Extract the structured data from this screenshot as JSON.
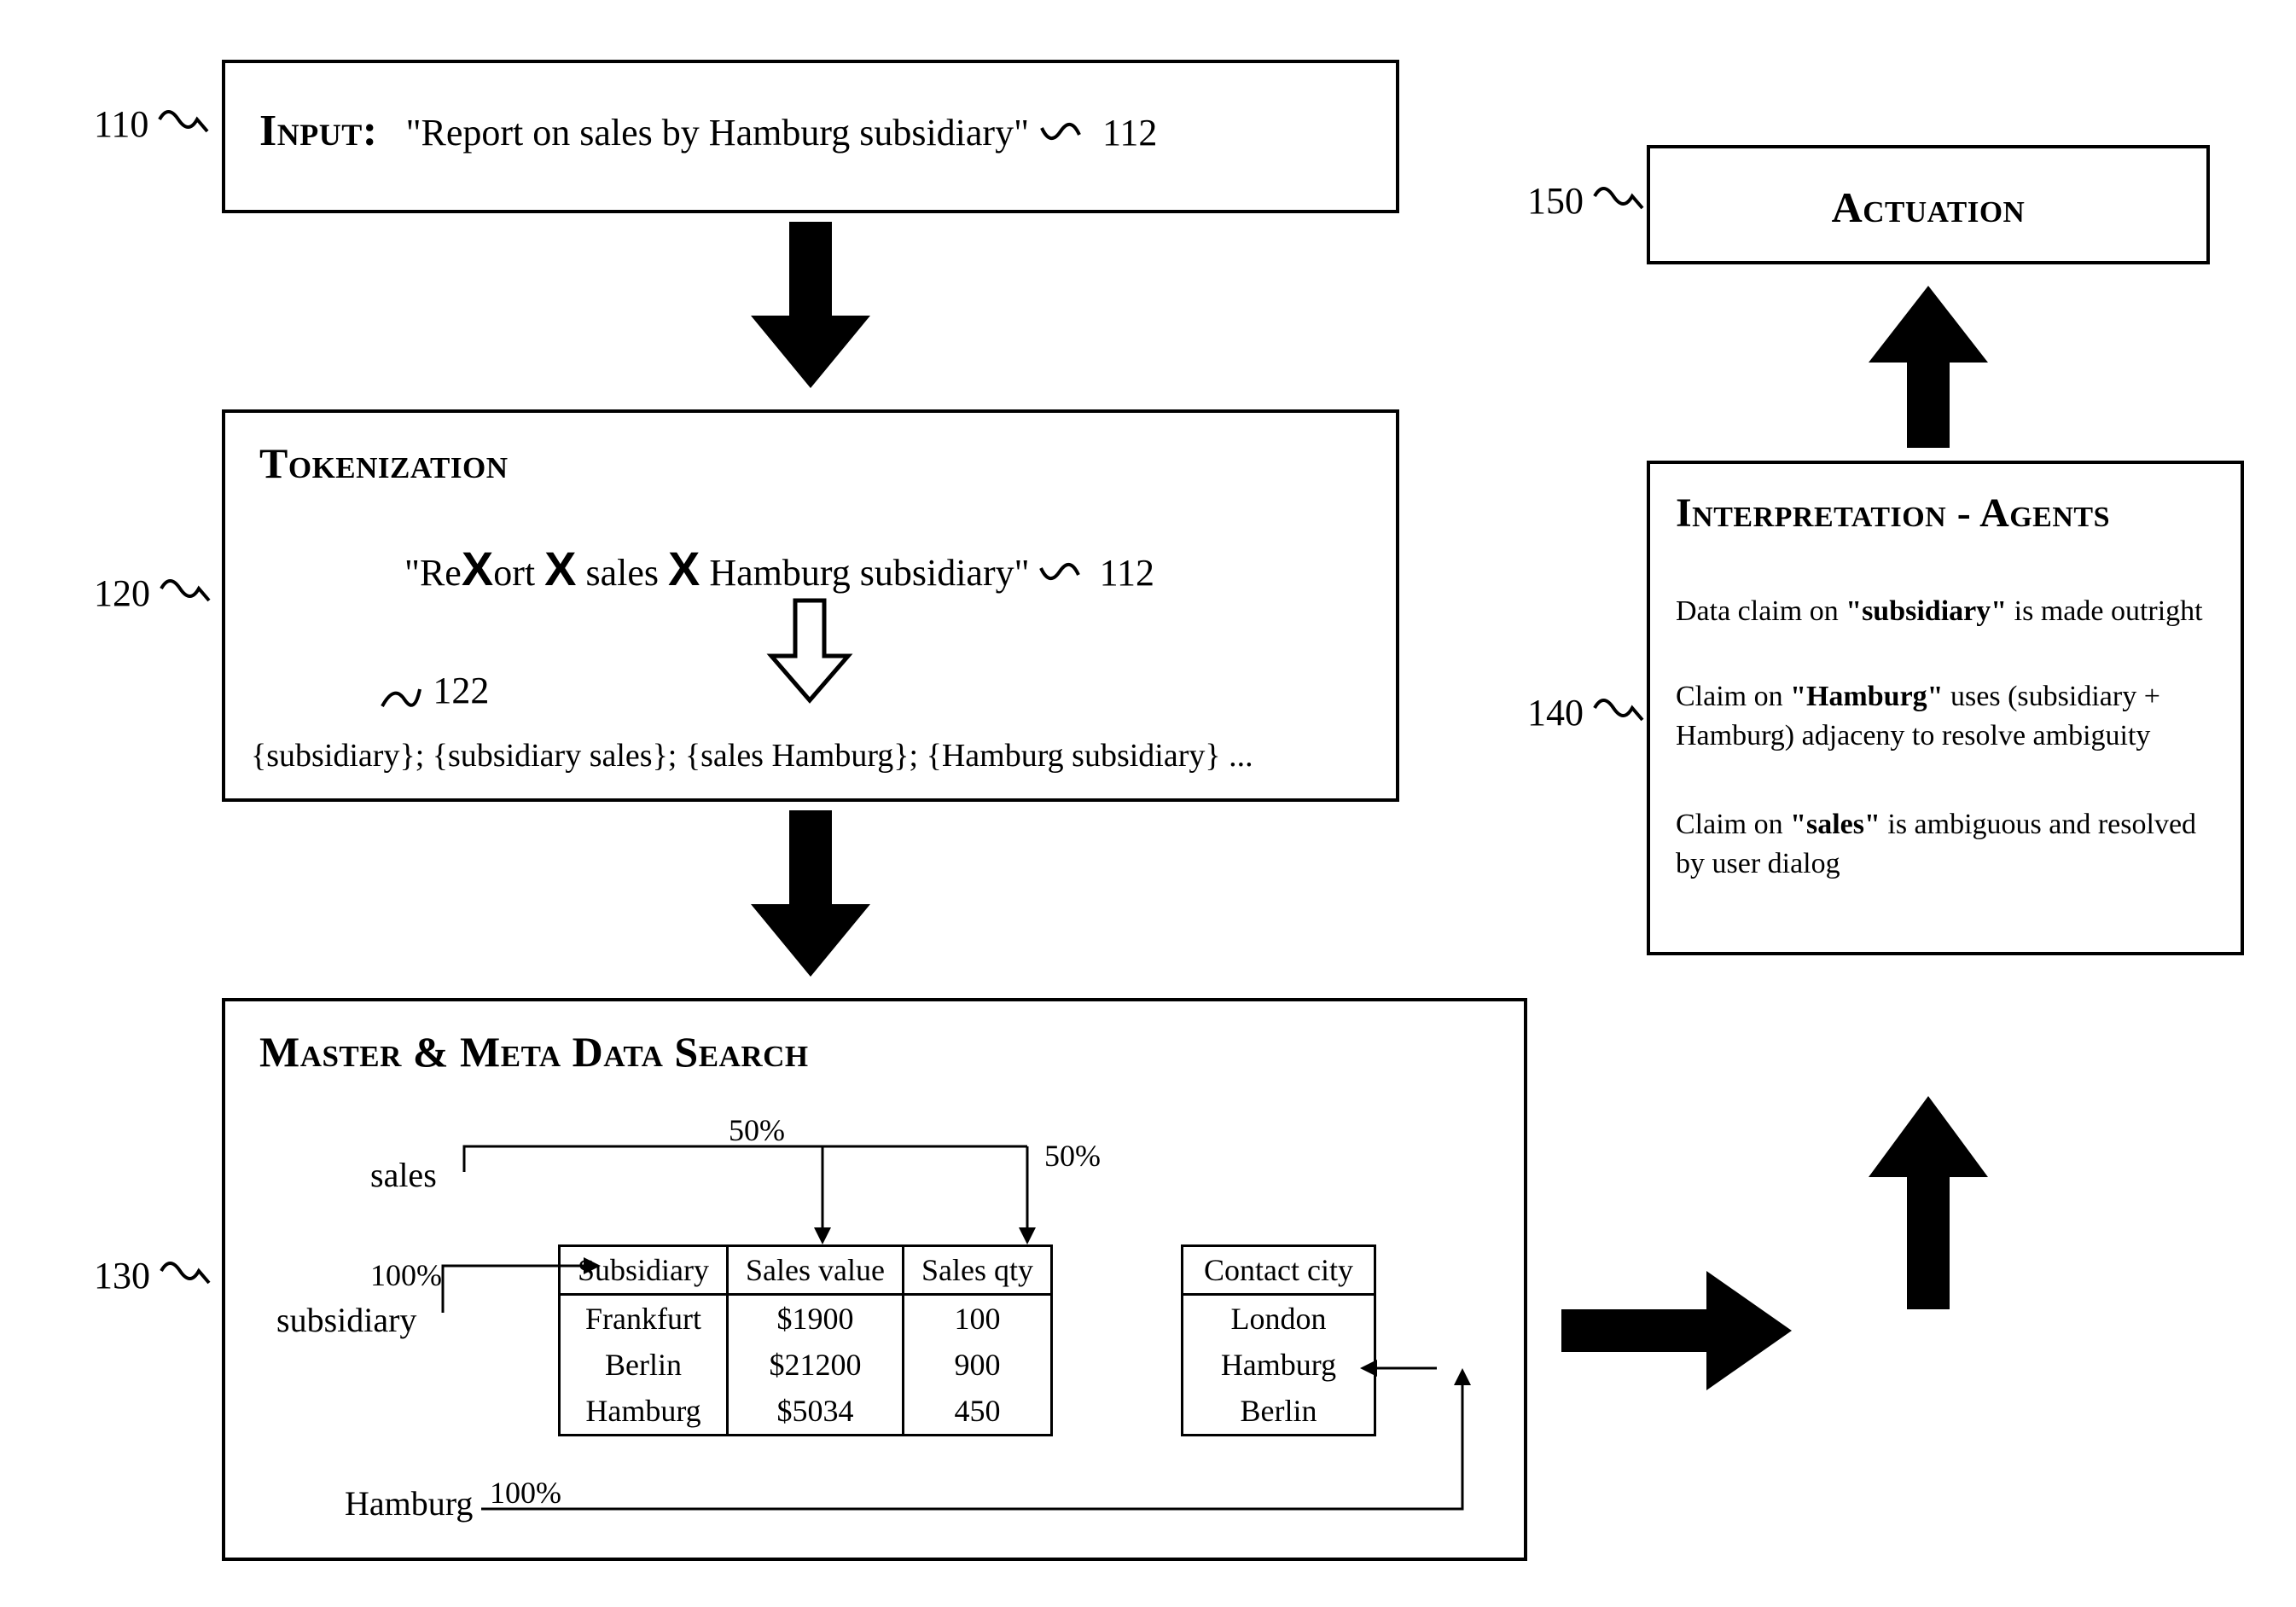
{
  "refs": {
    "r110": "110",
    "r112a": "112",
    "r112b": "112",
    "r120": "120",
    "r122": "122",
    "r130": "130",
    "r140": "140",
    "r150": "150"
  },
  "input": {
    "heading": "Input:",
    "text": "\"Report on sales by Hamburg subsidiary\""
  },
  "tokenization": {
    "heading": "Tokenization",
    "sentence_pre_x1": "\"Re",
    "sentence_mid1": "ort",
    "sentence_mid2": "sales",
    "sentence_mid3": "Hamburg subsidiary\"",
    "tokens_line": "{subsidiary}; {subsidiary sales}; {sales Hamburg}; {Hamburg subsidiary} ..."
  },
  "search": {
    "heading": "Master & Meta Data Search",
    "labels": {
      "sales": "sales",
      "subsidiary": "subsidiary",
      "hamburg": "Hamburg",
      "p50a": "50%",
      "p50b": "50%",
      "p100a": "100%",
      "p100b": "100%"
    },
    "table": {
      "headers": [
        "Subsidiary",
        "Sales value",
        "Sales qty"
      ],
      "rows": [
        [
          "Frankfurt",
          "$1900",
          "100"
        ],
        [
          "Berlin",
          "$21200",
          "900"
        ],
        [
          "Hamburg",
          "$5034",
          "450"
        ]
      ]
    },
    "contact": {
      "header": "Contact city",
      "rows": [
        "London",
        "Hamburg",
        "Berlin"
      ]
    }
  },
  "interpretation": {
    "heading": "Interpretation - Agents",
    "line1_a": "Data claim on ",
    "line1_b": "\"subsidiary\"",
    "line1_c": " is made outright",
    "line2_a": "Claim on ",
    "line2_b": "\"Hamburg\"",
    "line2_c": " uses (subsidiary + Hamburg) adjaceny to resolve ambiguity",
    "line3_a": "Claim on ",
    "line3_b": "\"sales\"",
    "line3_c": " is ambiguous and resolved by user dialog"
  },
  "actuation": {
    "heading": "Actuation"
  }
}
